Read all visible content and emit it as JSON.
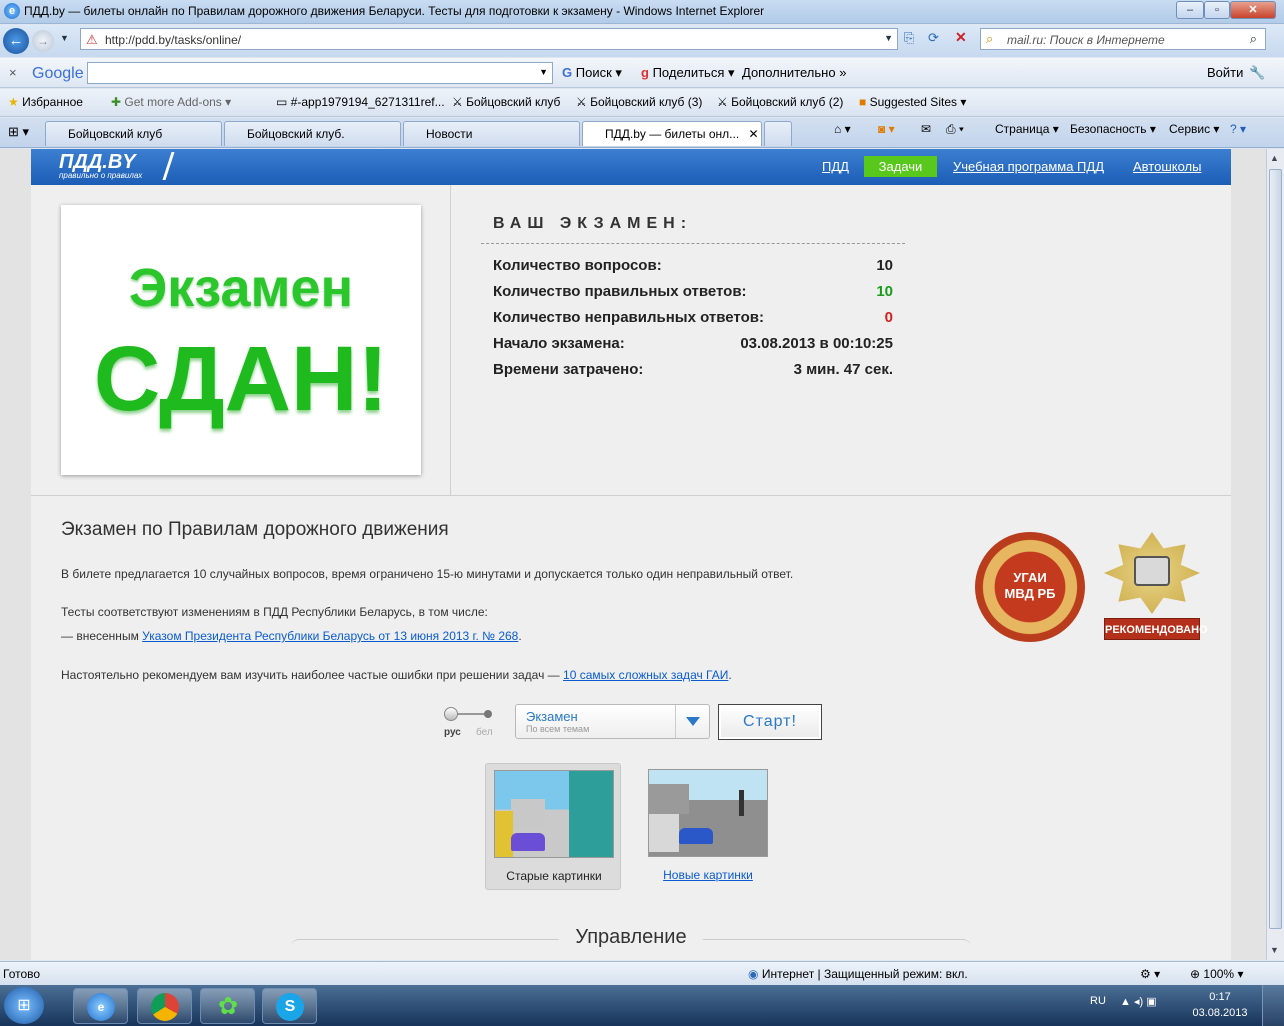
{
  "window": {
    "title": "ПДД.by — билеты онлайн по Правилам дорожного движения Беларуси. Тесты для подготовки к экзамену - Windows Internet Explorer"
  },
  "nav": {
    "url": "http://pdd.by/tasks/online/",
    "search_placeholder": "mail.ru: Поиск в Интернете"
  },
  "googlebar": {
    "logo": "Google",
    "search": "Поиск",
    "share": "Поделиться",
    "more": "Дополнительно",
    "login": "Войти"
  },
  "favorites": {
    "label": "Избранное",
    "items": [
      "Get more Add-ons",
      "#-app1979194_6271311ref...",
      "Бойцовский клуб",
      "Бойцовский клуб (3)",
      "Бойцовский клуб (2)",
      "Suggested Sites"
    ]
  },
  "tabs": [
    "Бойцовский клуб",
    "Бойцовский клуб.",
    "Новости",
    "ПДД.by — билеты онл..."
  ],
  "commands": [
    "Страница",
    "Безопасность",
    "Сервис"
  ],
  "site": {
    "logo": "ПДД.BY",
    "logo_sub": "правильно о правилах",
    "nav": [
      "ПДД",
      "Задачи",
      "Учебная программа ПДД",
      "Автошколы"
    ]
  },
  "result": {
    "line1": "Экзамен",
    "line2": "СДАН!"
  },
  "exam": {
    "title": "ВАШ ЭКЗАМЕН:",
    "rows": [
      {
        "label": "Количество вопросов:",
        "value": "10"
      },
      {
        "label": "Количество правильных ответов:",
        "value": "10"
      },
      {
        "label": "Количество неправильных ответов:",
        "value": "0"
      },
      {
        "label": "Начало экзамена:",
        "value": "03.08.2013 в 00:10:25"
      },
      {
        "label": "Времени затрачено:",
        "value": "3 мин. 47 сек."
      }
    ],
    "colors": {
      "correct": "#1b9a1b",
      "wrong": "#d21f1f"
    }
  },
  "info": {
    "heading": "Экзамен по Правилам дорожного движения",
    "p1": "В билете предлагается 10 случайных вопросов, время ограничено 15-ю минутами и допускается только один неправильный ответ.",
    "p2": "Тесты соответствуют изменениям в ПДД Республики Беларусь, в том числе:",
    "p3_prefix": "— внесенным",
    "p3_link": "Указом Президента Республики Беларусь от 13 июня 2013 г. № 268",
    "p3_suffix": ".",
    "p4_prefix": "Настоятельно рекомендуем вам изучить наиболее частые ошибки при решении задач —",
    "p4_link": "10 самых сложных задач ГАИ",
    "p4_suffix": "."
  },
  "seals": {
    "seal1": "УГАИ\nМВД РБ",
    "seal2": "РЕКОМЕНДОВАНО"
  },
  "controls": {
    "lang_rus": "рус",
    "lang_bel": "бел",
    "select_value": "Экзамен",
    "select_sub": "По всем темам",
    "start": "Старт!"
  },
  "pictures": {
    "old": "Старые картинки",
    "new": "Новые картинки"
  },
  "management": "Управление",
  "status": {
    "ready": "Готово",
    "zone": "Интернет | Защищенный режим: вкл.",
    "zoom": "100%"
  },
  "taskbar": {
    "lang": "RU",
    "time": "0:17",
    "date": "03.08.2013"
  }
}
